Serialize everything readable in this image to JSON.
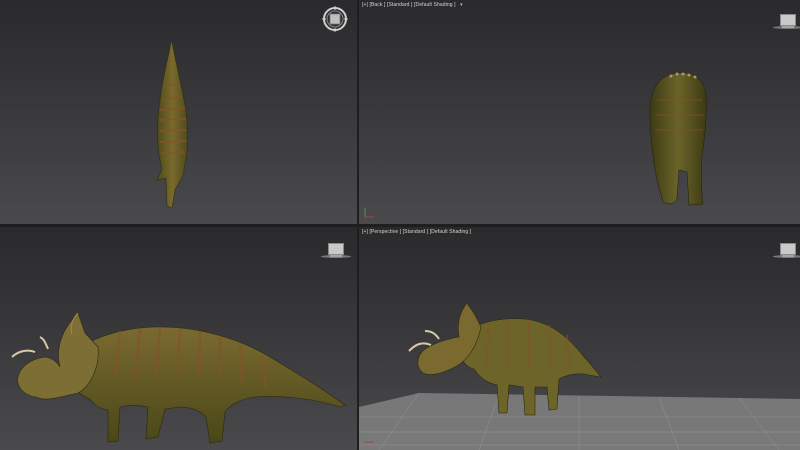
{
  "viewports": {
    "top_left": {
      "label": ""
    },
    "top_right": {
      "label": "[+] [Back ] [Standard ] [Default Shading ]",
      "menu_icon": "filter-funnel-icon"
    },
    "bottom_left": {
      "label": ""
    },
    "bottom_right": {
      "label": "[+] [Perspective ] [Standard ] [Default Shading ]"
    }
  },
  "icons": {
    "navigation": "view-cube-icon",
    "steering": "steering-wheel-icon",
    "axis": "axis-tripod-icon"
  },
  "colors": {
    "viewport_bg_top": "#2a2a2c",
    "viewport_bg_bottom": "#4a4a4d",
    "model_body": "#6d6a2a",
    "model_stripes": "#8a4f2e",
    "grid_floor": "#8c8c8c"
  }
}
